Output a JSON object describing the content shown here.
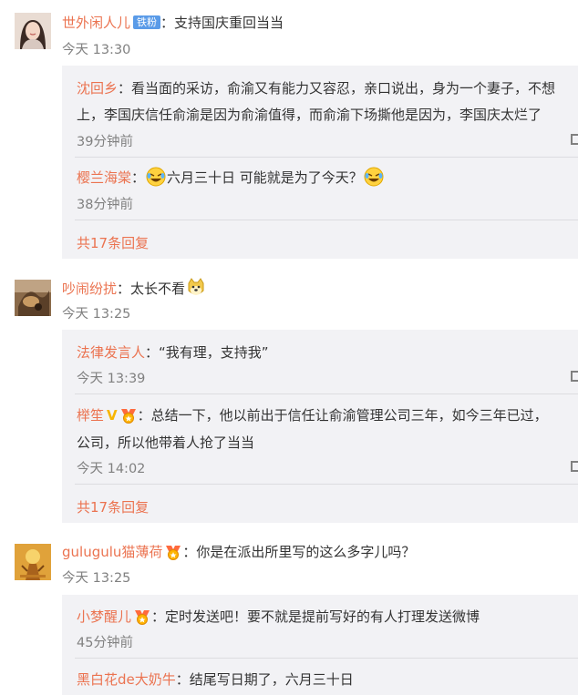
{
  "colors": {
    "accent": "#eb7350",
    "reply_bg": "#f2f2f5",
    "time": "#808080",
    "badge_blue": "#5a9be8"
  },
  "comments": [
    {
      "user": "世外闲人儿",
      "badge": "铁粉",
      "text": "：支持国庆重回当当",
      "time": "今天 13:30",
      "replies": [
        {
          "user": "沈回乡",
          "text_line1": "：看当面的采访，俞渝又有能力又容忍，亲口说出，身为一个妻子，不想",
          "text_line2": "上，李国庆信任俞渝是因为俞渝值得，而俞渝下场撕他是因为，李国庆太烂了",
          "time": "39分钟前"
        },
        {
          "user": "樱兰海棠",
          "text_pre": "：",
          "text": "六月三十日  可能就是为了今天？",
          "time": "38分钟前"
        }
      ],
      "more": "共17条回复"
    },
    {
      "user": "吵闹纷扰",
      "text": "：太长不看",
      "time": "今天 13:25",
      "replies": [
        {
          "user": "法律发言人",
          "text": "：“我有理，支持我”",
          "time": "今天 13:39"
        },
        {
          "user": "榉笙",
          "text_line1": "：总结一下，他以前出于信任让俞渝管理公司三年，如今三年已过，",
          "text_line2": "公司，所以他带着人抢了当当",
          "time": "今天 14:02"
        }
      ],
      "more": "共17条回复"
    },
    {
      "user": "gulugulu猫薄荷",
      "text": "：你是在派出所里写的这么多字儿吗？",
      "time": "今天 13:25",
      "replies": [
        {
          "user": "小梦醒儿",
          "text": "：定时发送吧！要不就是提前写好的有人打理发送微博",
          "time": "45分钟前"
        },
        {
          "user": "黑白花de大奶牛",
          "text": "：结尾写日期了，六月三十日"
        }
      ]
    }
  ]
}
